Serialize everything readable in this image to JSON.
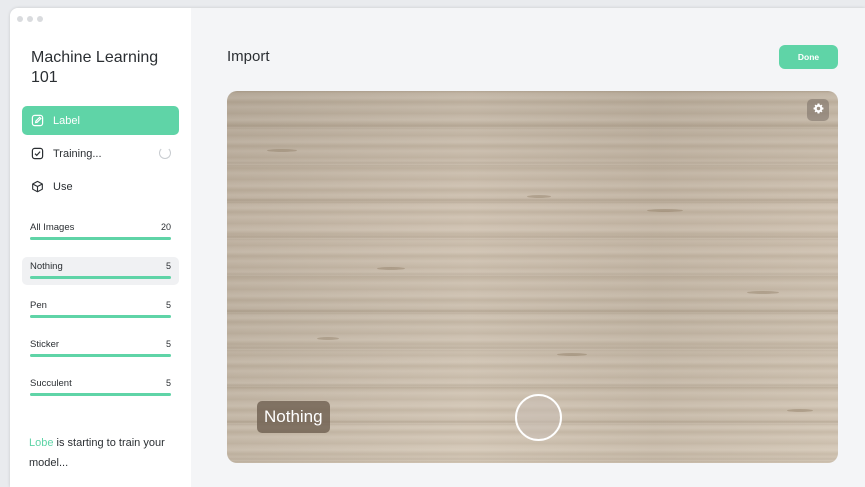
{
  "sidebar": {
    "project_title": "Machine Learning 101",
    "nav": [
      {
        "label": "Label",
        "icon": "edit-icon",
        "active": true
      },
      {
        "label": "Training...",
        "icon": "checkbox-icon",
        "active": false
      },
      {
        "label": "Use",
        "icon": "cube-icon",
        "active": false
      }
    ],
    "labels": [
      {
        "name": "All Images",
        "count": "20",
        "progress": 1.0
      },
      {
        "name": "Nothing",
        "count": "5",
        "progress": 1.0
      },
      {
        "name": "Pen",
        "count": "5",
        "progress": 1.0
      },
      {
        "name": "Sticker",
        "count": "5",
        "progress": 1.0
      },
      {
        "name": "Succulent",
        "count": "5",
        "progress": 1.0
      }
    ],
    "status": {
      "brand": "Lobe",
      "text": " is starting to train your model..."
    }
  },
  "main": {
    "title": "Import",
    "done_label": "Done",
    "camera": {
      "prediction": "Nothing",
      "settings_icon": "gear-icon",
      "capture_icon": "shutter-circle-icon"
    }
  },
  "colors": {
    "accent": "#5fd4a7",
    "text": "#2b2f33",
    "sidebar_bg": "#ffffff",
    "main_bg": "#f4f5f7"
  }
}
